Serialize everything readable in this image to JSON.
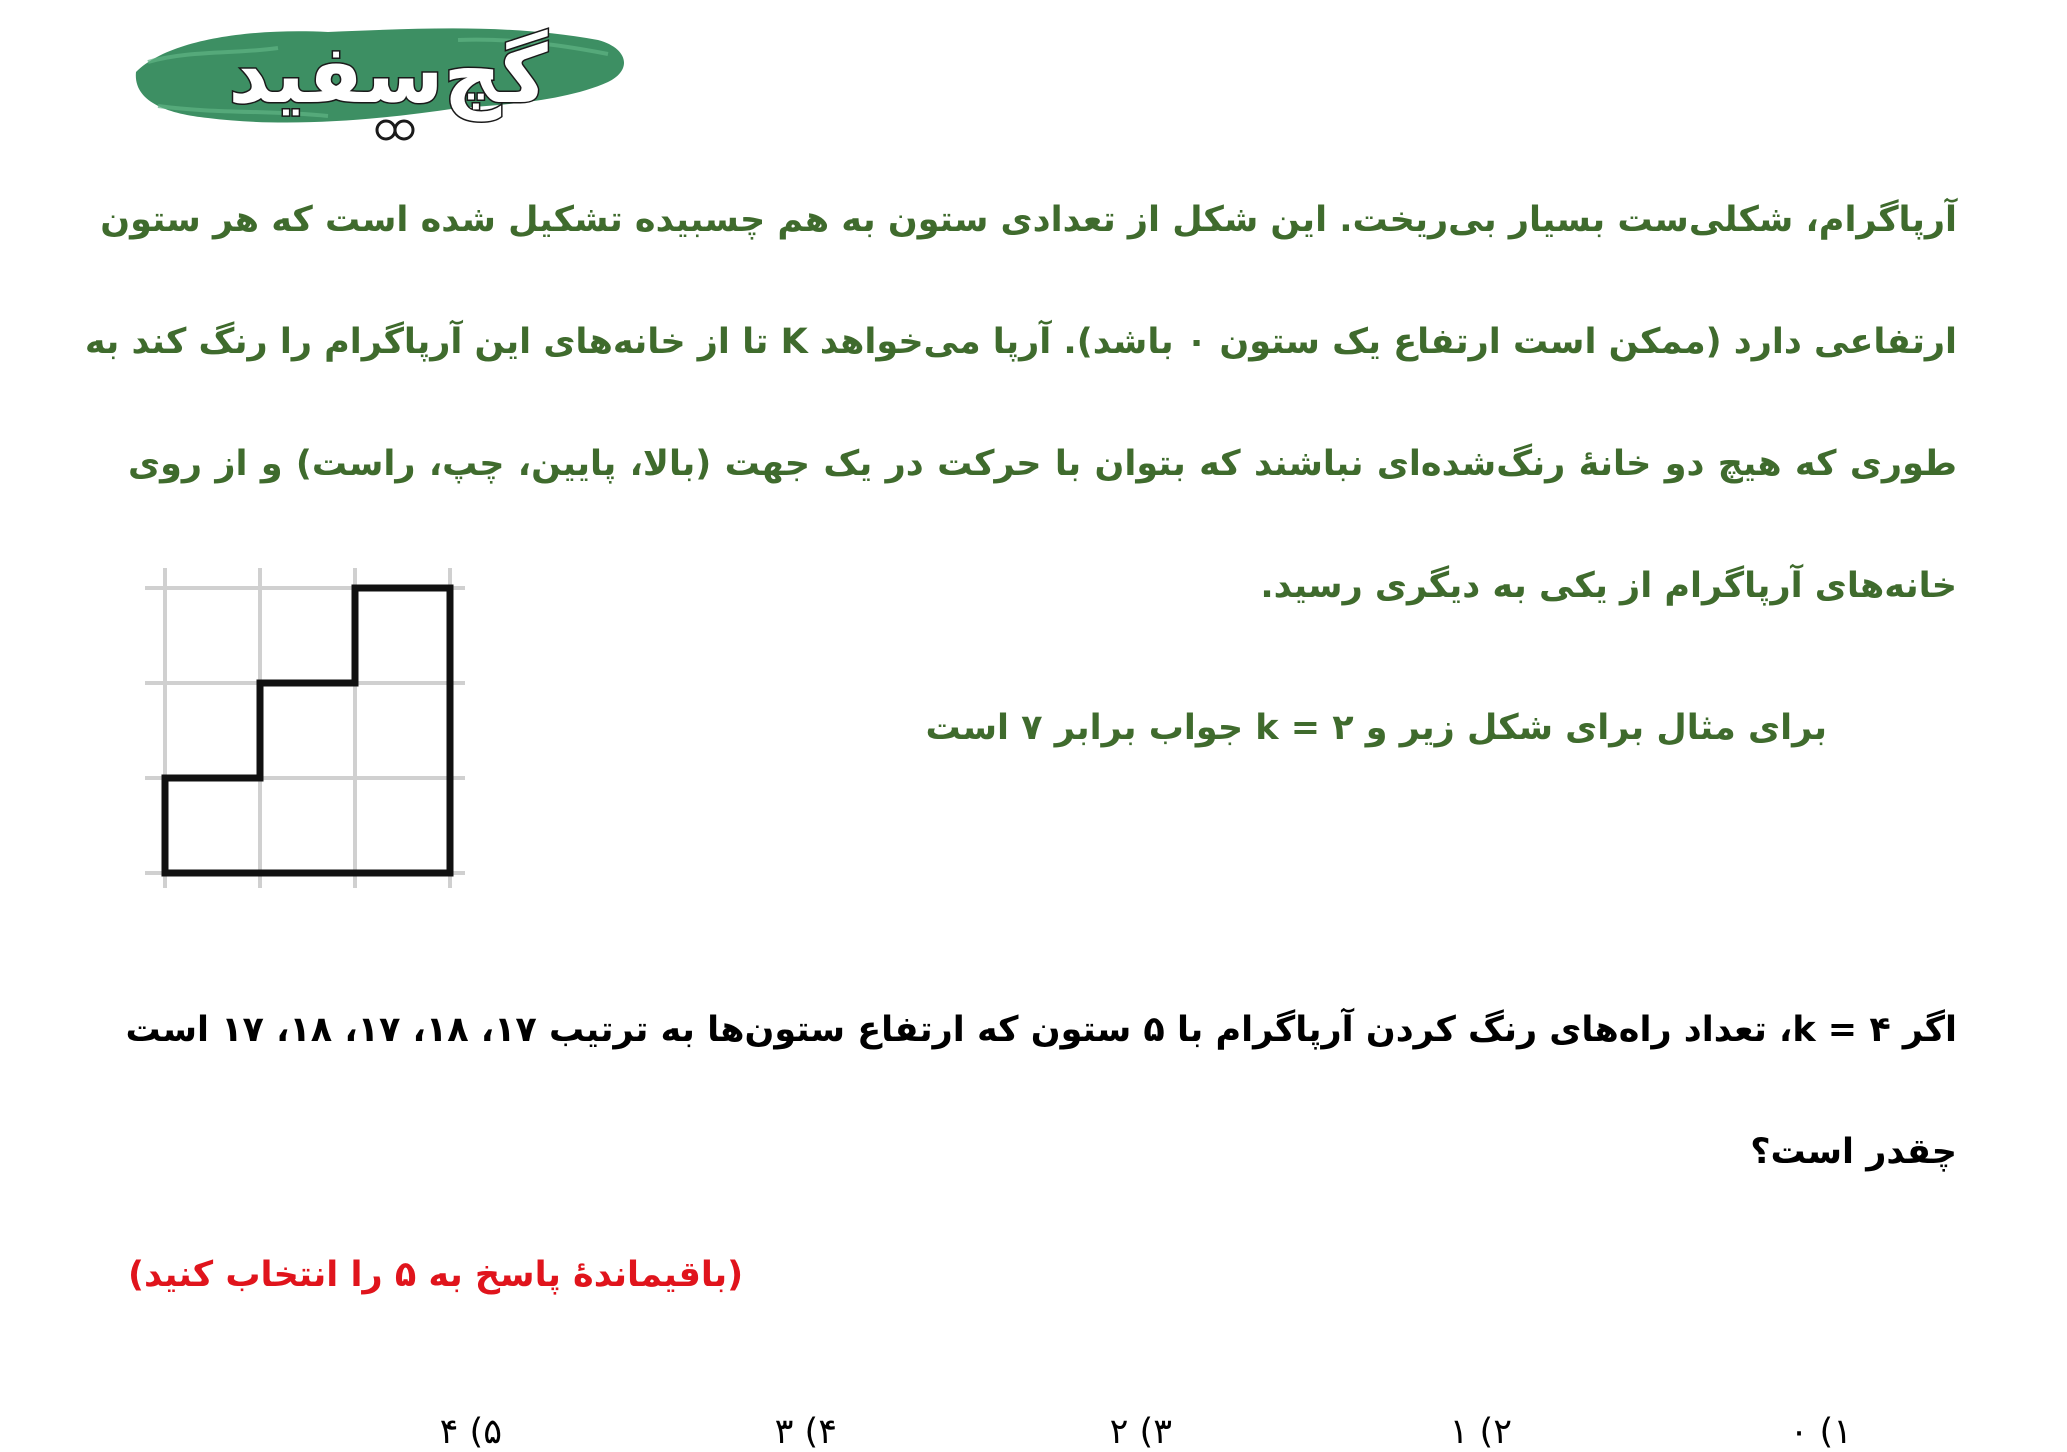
{
  "logo": {
    "text": "گچ‌سفید",
    "colors": {
      "brush": "#3d8f63",
      "text": "#ffffff",
      "outline": "#1a1a1a"
    }
  },
  "intro": {
    "lines": [
      "آرپاگرام، شکلی‌ست بسیار بی‌ریخت. این شکل از تعدادی ستون به هم چسبیده تشکیل شده است که هر ستون",
      "ارتفاعی دارد (ممکن است ارتفاع یک ستون ۰ باشد). آرپا می‌خواهد K تا از خانه‌های این آرپاگرام را رنگ کند به",
      "طوری که هیچ دو خانهٔ رنگ‌شده‌ای نباشند که بتوان با حرکت در یک جهت (بالا، پایین، چپ، راست) و از روی",
      "خانه‌های آرپاگرام از یکی به دیگری رسید."
    ],
    "color": "#3f6b2d"
  },
  "example": {
    "text": "برای مثال برای شکل زیر و k = ۲ جواب برابر ۷ است",
    "figure": {
      "grid_columns": 3,
      "grid_rows": 3,
      "column_heights": [
        1,
        2,
        3
      ],
      "grid_color": "#d0d0d0",
      "outline_color": "#111111"
    }
  },
  "question": {
    "lines": [
      "اگر k = ۴، تعداد راه‌های رنگ کردن آرپاگرام با ۵ ستون که ارتفاع ستون‌ها به ترتیب ۱۷، ۱۸، ۱۷، ۱۸، ۱۷ است",
      "چقدر است؟"
    ],
    "color": "#000000"
  },
  "note": {
    "text": "(باقیماندهٔ پاسخ به ۵ را انتخاب کنید)",
    "color": "#e0141c"
  },
  "choices": [
    "۱) ۰",
    "۲) ۱",
    "۳) ۲",
    "۴) ۳",
    "۵) ۴"
  ]
}
